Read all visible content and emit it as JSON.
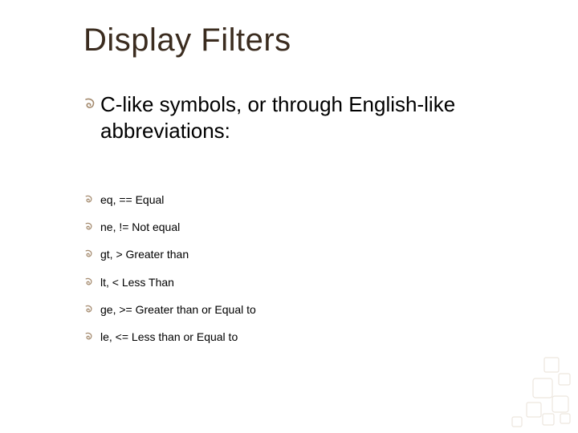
{
  "title": "Display Filters",
  "intro": "C-like symbols, or through English-like abbreviations:",
  "bullets": [
    "eq, == Equal",
    "ne, != Not equal",
    "gt, > Greater than",
    "lt, < Less Than",
    "ge, >= Greater than or Equal to",
    "le, <= Less than or Equal to"
  ],
  "icons": {
    "bullet_large": "swirl-bullet",
    "bullet_small": "swirl-bullet"
  },
  "colors": {
    "title": "#3b2c1f",
    "bullet": "#a58b6f",
    "corner": "#c9b8a3"
  }
}
